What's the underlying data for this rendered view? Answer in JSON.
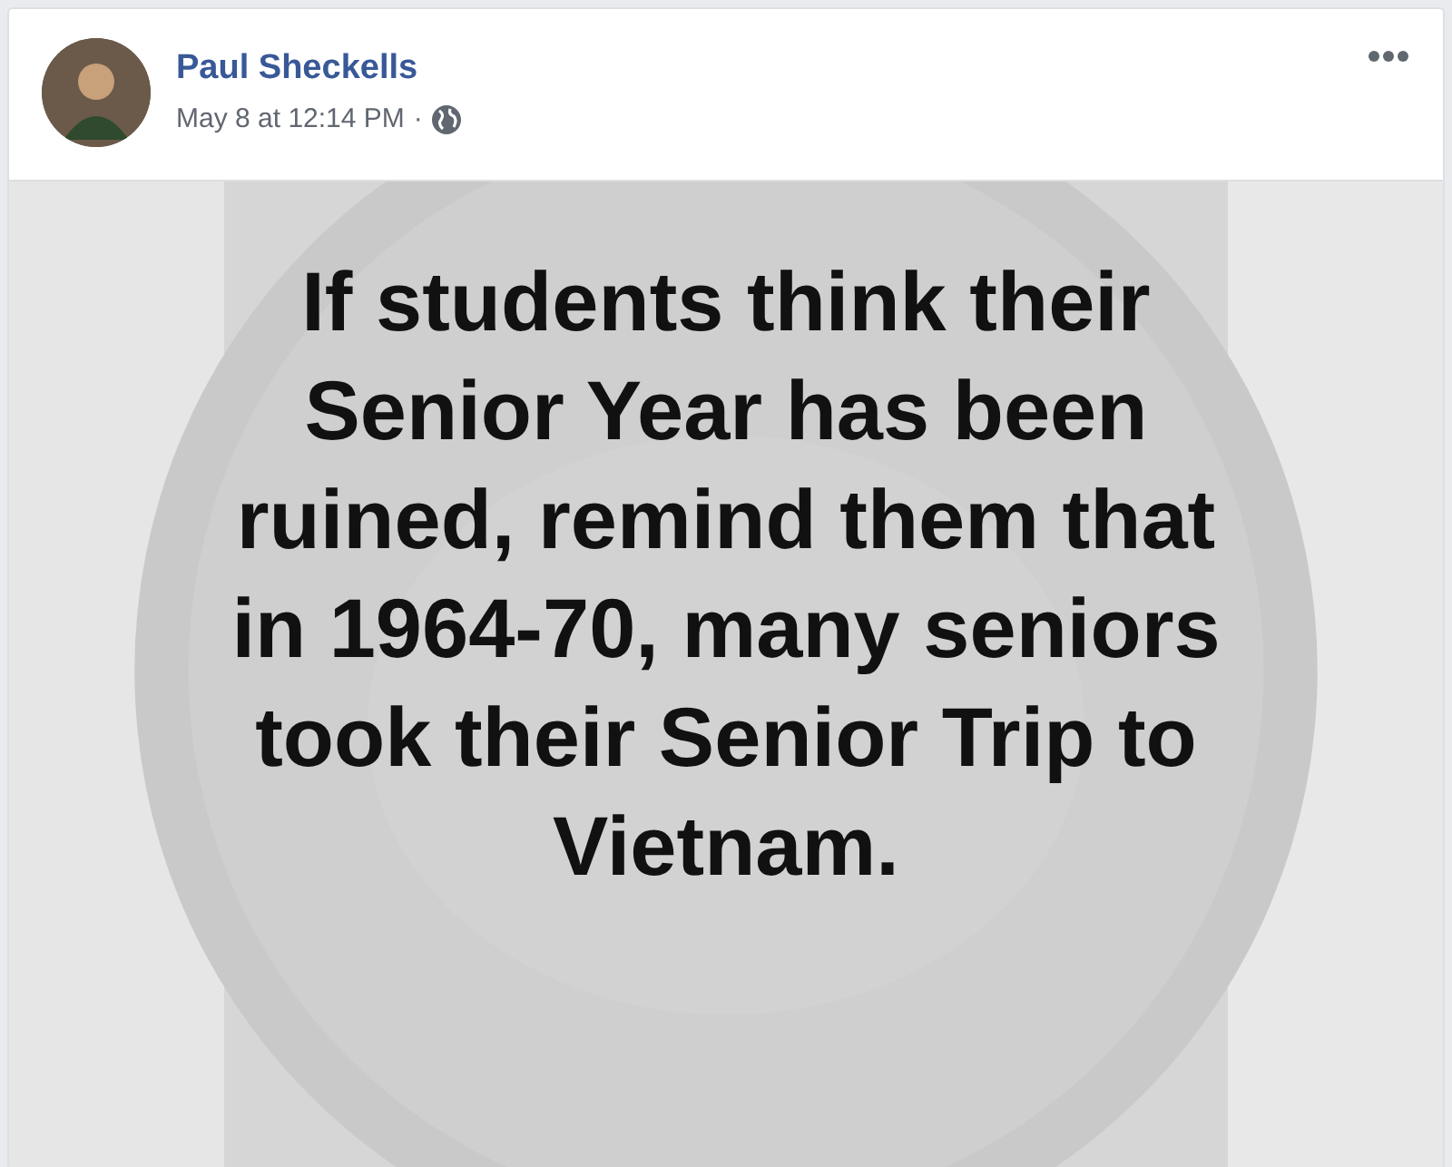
{
  "post": {
    "author": "Paul Sheckells",
    "timestamp": "May 8 at 12:14 PM",
    "separator": "·",
    "image_text": [
      "If students think their",
      "Senior Year has been",
      "ruined, remind them that",
      "in 1964-70, many seniors",
      "took their Senior Trip to",
      "Vietnam."
    ]
  }
}
